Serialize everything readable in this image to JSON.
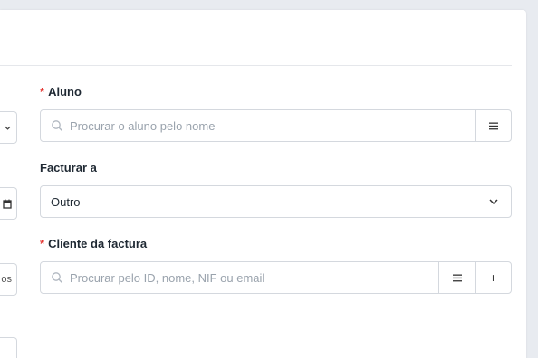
{
  "form": {
    "aluno": {
      "required_mark": "*",
      "label": "Aluno",
      "placeholder": "Procurar o aluno pelo nome",
      "list_icon": "list-icon"
    },
    "facturar_a": {
      "label": "Facturar a",
      "selected": "Outro",
      "icon": "chevron-down-icon"
    },
    "cliente": {
      "required_mark": "*",
      "label": "Cliente da factura",
      "placeholder": "Procurar pelo ID, nome, NIF ou email",
      "list_icon": "list-icon",
      "add_label": "+"
    }
  },
  "left_column_fragments": {
    "third_text": "os"
  },
  "colors": {
    "required": "#e53935",
    "border": "#d4d8de",
    "background": "#e8ebf0"
  }
}
